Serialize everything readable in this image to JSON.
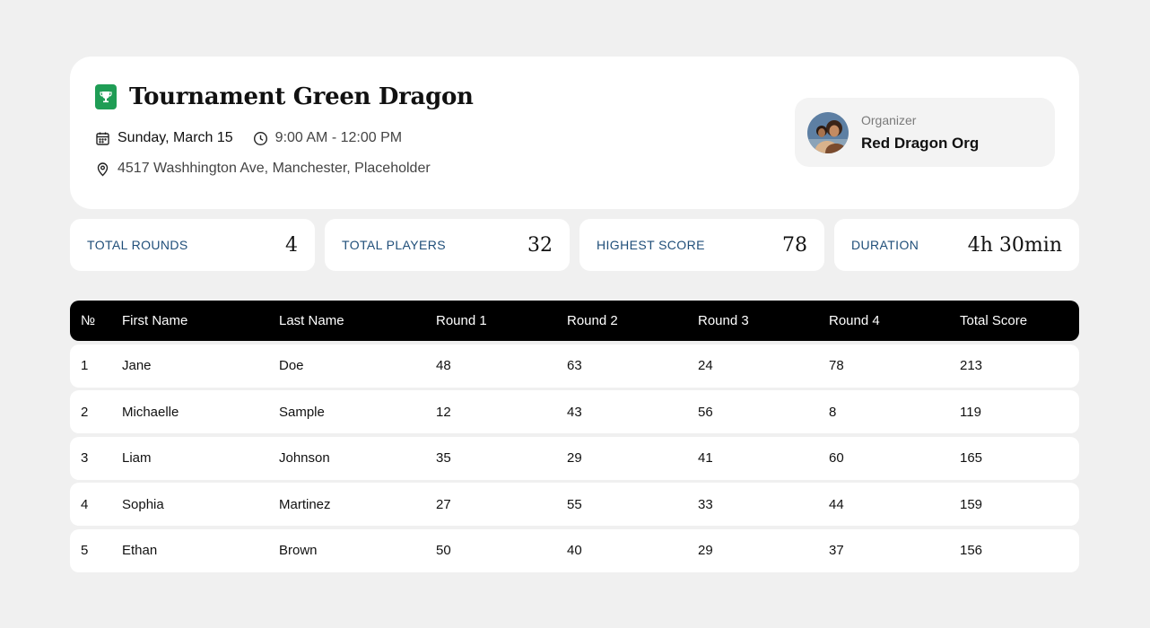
{
  "header": {
    "title": "Tournament Green Dragon",
    "date": "Sunday, March 15",
    "time": "9:00 AM - 12:00 PM",
    "location": "4517 Washhington Ave, Manchester, Placeholder",
    "brand_color": "#1f9d55"
  },
  "organizer": {
    "label": "Organizer",
    "name": "Red Dragon Org"
  },
  "stats": [
    {
      "label": "TOTAL ROUNDS",
      "value": "4"
    },
    {
      "label": "TOTAL PLAYERS",
      "value": "32"
    },
    {
      "label": "HIGHEST SCORE",
      "value": "78"
    },
    {
      "label": "DURATION",
      "value": "4h 30min"
    }
  ],
  "table": {
    "columns": [
      "№",
      "First Name",
      "Last Name",
      "Round 1",
      "Round 2",
      "Round 3",
      "Round 4",
      "Total Score"
    ],
    "rows": [
      [
        "1",
        "Jane",
        "Doe",
        "48",
        "63",
        "24",
        "78",
        "213"
      ],
      [
        "2",
        "Michaelle",
        "Sample",
        "12",
        "43",
        "56",
        "8",
        "119"
      ],
      [
        "3",
        "Liam",
        "Johnson",
        "35",
        "29",
        "41",
        "60",
        "165"
      ],
      [
        "4",
        "Sophia",
        "Martinez",
        "27",
        "55",
        "33",
        "44",
        "159"
      ],
      [
        "5",
        "Ethan",
        "Brown",
        "50",
        "40",
        "29",
        "37",
        "156"
      ]
    ]
  }
}
